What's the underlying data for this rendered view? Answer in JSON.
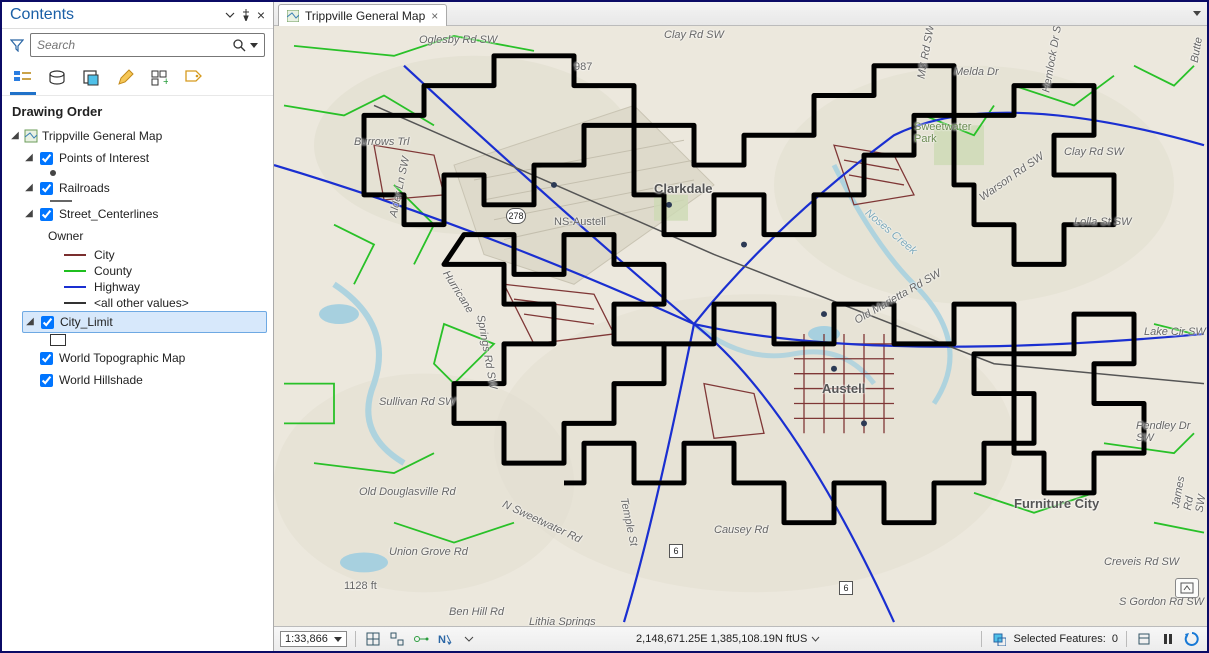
{
  "contents": {
    "title": "Contents",
    "search_placeholder": "Search",
    "section": "Drawing Order",
    "root": "Trippville General Map",
    "layers": {
      "poi": "Points of Interest",
      "railroads": "Railroads",
      "streets": "Street_Centerlines",
      "streets_field": "Owner",
      "city": "City_Limit",
      "topo": "World Topographic Map",
      "hillshade": "World Hillshade"
    },
    "streets_legend": {
      "city": "City",
      "county": "County",
      "highway": "Highway",
      "other": "<all other values>"
    }
  },
  "tab": {
    "title": "Trippville General Map"
  },
  "statusbar": {
    "scale": "1:33,866",
    "coords": "2,148,671.25E 1,385,108.19N ftUS",
    "selected_label": "Selected Features:",
    "selected_count": "0"
  },
  "map_labels": {
    "clarkdale": "Clarkdale",
    "austell": "Austell",
    "furniture_city": "Furniture City",
    "sweetwater_park": "Sweetwater Park",
    "lake_cir": "Lake Cir SW",
    "oglesby": "Oglesby Rd SW",
    "clay": "Clay Rd SW",
    "clay2": "Clay Rd SW",
    "burrows": "Burrows Trl",
    "alder": "Alder Ln SW",
    "ns_austell": "NS-Austell",
    "hwy278": "278",
    "noses": "Noses Creek",
    "sullivan": "Sullivan Rd SW",
    "douglasville": "Old Douglasville Rd",
    "union_grove": "Union Grove Rd",
    "sweetwater_rd": "N Sweetwater Rd",
    "temple": "Temple St",
    "causey": "Causey Rd",
    "lithia": "Lithia Springs",
    "benhill": "Ben Hill Rd",
    "elev": "1128 ft",
    "hwy6a": "6",
    "hwy6b": "6",
    "pendley": "Pendley Dr SW",
    "marietta": "Old Marietta Rd SW",
    "warson": "Warson Rd SW",
    "melda": "Melda Dr",
    "hemlock": "Hemlock Dr SW",
    "lolla": "Lolla St SW",
    "james": "James Rd SW",
    "gordon": "S Gordon Rd SW",
    "creveis": "Creveis Rd SW",
    "ms": "MS Rd SW",
    "butte": "Butte",
    "num987": "987",
    "springs": "Springs Rd SW",
    "hurricane": "Hurricane"
  }
}
